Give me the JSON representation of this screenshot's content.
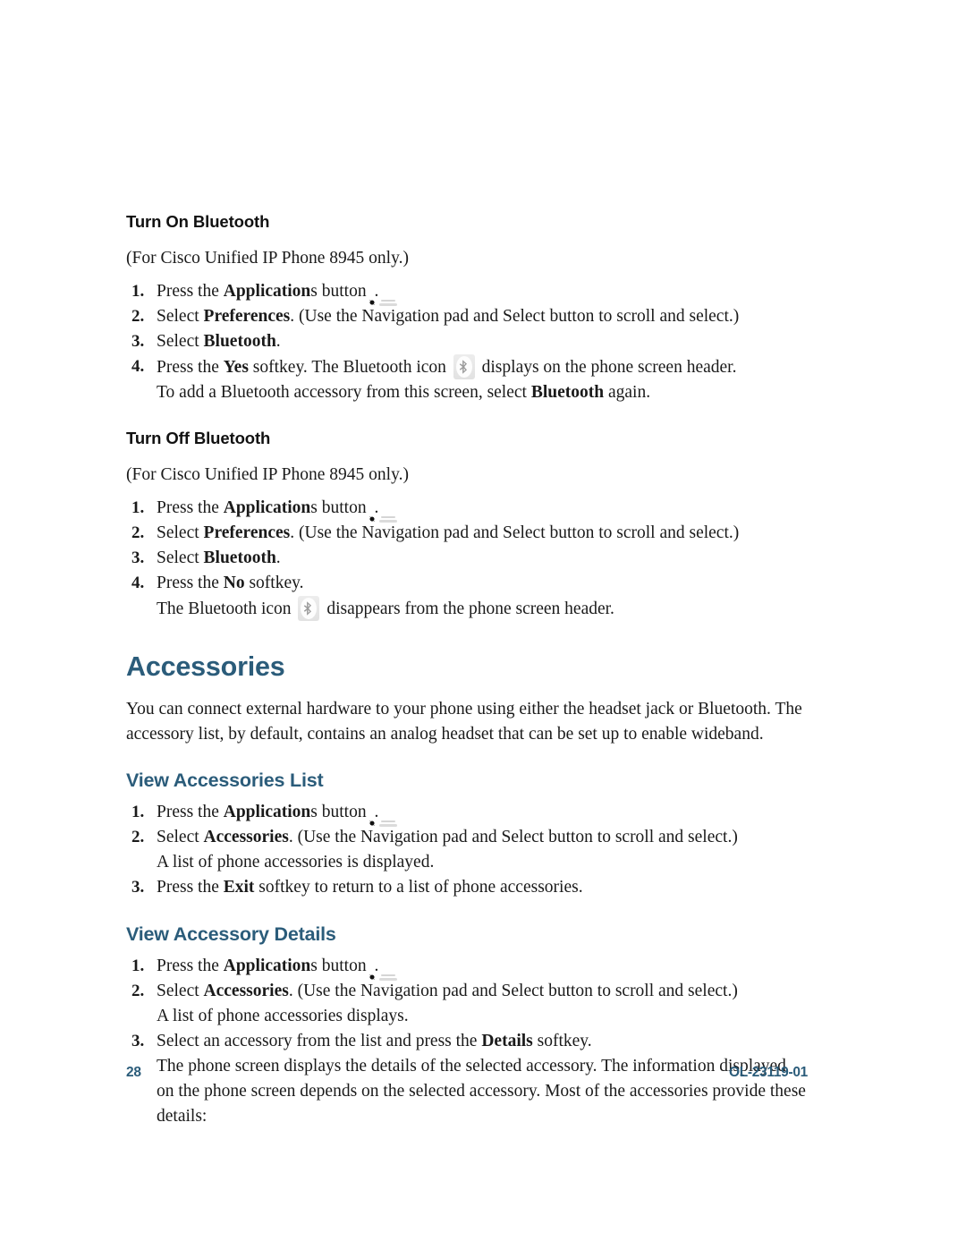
{
  "document": {
    "page_number": "28",
    "doc_id": "OL-23119-01",
    "accent_color": "#2b5c7a",
    "text_color": "#1a1a1a"
  },
  "icons": {
    "applications_button": "applications-gear-button-icon",
    "bluetooth_badge": "bluetooth-status-icon"
  },
  "sections": [
    {
      "id": "turn-on-bluetooth",
      "heading": "Turn On Bluetooth",
      "heading_style": "sub-head",
      "note": "(For Cisco Unified IP Phone 8945 only.)",
      "steps": [
        {
          "num": "1.",
          "parts": [
            {
              "t": "Press the ",
              "b": false
            },
            {
              "t": "Application",
              "b": true
            },
            {
              "t": "s button ",
              "b": false
            },
            {
              "t": "",
              "icon": "apps"
            },
            {
              "t": ".",
              "b": false
            }
          ]
        },
        {
          "num": "2.",
          "parts": [
            {
              "t": "Select ",
              "b": false
            },
            {
              "t": "Preferences",
              "b": true
            },
            {
              "t": ". (Use the Navigation pad and Select button to scroll and select.)",
              "b": false
            }
          ]
        },
        {
          "num": "3.",
          "parts": [
            {
              "t": "Select ",
              "b": false
            },
            {
              "t": "Bluetooth",
              "b": true
            },
            {
              "t": ".",
              "b": false
            }
          ]
        },
        {
          "num": "4.",
          "parts": [
            {
              "t": "Press the ",
              "b": false
            },
            {
              "t": "Yes",
              "b": true
            },
            {
              "t": " softkey. The Bluetooth icon ",
              "b": false
            },
            {
              "t": "",
              "icon": "bt"
            },
            {
              "t": " displays on the phone screen header.",
              "b": false
            }
          ],
          "continuation": [
            {
              "t": "To add a Bluetooth accessory from this screen, select ",
              "b": false
            },
            {
              "t": "Bluetooth",
              "b": true
            },
            {
              "t": " again.",
              "b": false
            }
          ]
        }
      ]
    },
    {
      "id": "turn-off-bluetooth",
      "heading": "Turn Off Bluetooth",
      "heading_style": "sub-head",
      "note": "(For Cisco Unified IP Phone 8945 only.)",
      "steps": [
        {
          "num": "1.",
          "parts": [
            {
              "t": "Press the ",
              "b": false
            },
            {
              "t": "Application",
              "b": true
            },
            {
              "t": "s button ",
              "b": false
            },
            {
              "t": "",
              "icon": "apps"
            },
            {
              "t": ".",
              "b": false
            }
          ]
        },
        {
          "num": "2.",
          "parts": [
            {
              "t": "Select ",
              "b": false
            },
            {
              "t": "Preferences",
              "b": true
            },
            {
              "t": ". (Use the Navigation pad and Select button to scroll and select.)",
              "b": false
            }
          ]
        },
        {
          "num": "3.",
          "parts": [
            {
              "t": "Select ",
              "b": false
            },
            {
              "t": "Bluetooth",
              "b": true
            },
            {
              "t": ".",
              "b": false
            }
          ]
        },
        {
          "num": "4.",
          "parts": [
            {
              "t": "Press the ",
              "b": false
            },
            {
              "t": "No",
              "b": true
            },
            {
              "t": " softkey.",
              "b": false
            }
          ],
          "continuation": [
            {
              "t": "The Bluetooth icon ",
              "b": false
            },
            {
              "t": "",
              "icon": "bt"
            },
            {
              "t": " disappears from the phone screen header.",
              "b": false
            }
          ]
        }
      ]
    },
    {
      "id": "accessories",
      "heading": "Accessories",
      "heading_style": "section-title",
      "paragraph": "You can connect external hardware to your phone using either the headset jack or Bluetooth. The accessory list, by default, contains an analog headset that can be set up to enable wideband."
    },
    {
      "id": "view-accessories-list",
      "heading": "View Accessories List",
      "heading_style": "blue-head",
      "steps": [
        {
          "num": "1.",
          "parts": [
            {
              "t": "Press the ",
              "b": false
            },
            {
              "t": "Application",
              "b": true
            },
            {
              "t": "s button ",
              "b": false
            },
            {
              "t": "",
              "icon": "apps"
            },
            {
              "t": ".",
              "b": false
            }
          ]
        },
        {
          "num": "2.",
          "parts": [
            {
              "t": "Select ",
              "b": false
            },
            {
              "t": "Accessories",
              "b": true
            },
            {
              "t": ". (Use the Navigation pad and Select button to scroll and select.)",
              "b": false
            }
          ],
          "continuation": [
            {
              "t": "A list of phone accessories is displayed.",
              "b": false
            }
          ]
        },
        {
          "num": "3.",
          "parts": [
            {
              "t": "Press the ",
              "b": false
            },
            {
              "t": "Exit",
              "b": true
            },
            {
              "t": " softkey to return to a list of phone accessories.",
              "b": false
            }
          ]
        }
      ]
    },
    {
      "id": "view-accessory-details",
      "heading": "View Accessory Details",
      "heading_style": "blue-head",
      "steps": [
        {
          "num": "1.",
          "parts": [
            {
              "t": "Press the ",
              "b": false
            },
            {
              "t": "Application",
              "b": true
            },
            {
              "t": "s button ",
              "b": false
            },
            {
              "t": "",
              "icon": "apps"
            },
            {
              "t": ".",
              "b": false
            }
          ]
        },
        {
          "num": "2.",
          "parts": [
            {
              "t": "Select ",
              "b": false
            },
            {
              "t": "Accessories",
              "b": true
            },
            {
              "t": ". (Use the Navigation pad and Select button to scroll and select.)",
              "b": false
            }
          ],
          "continuation": [
            {
              "t": "A list of phone accessories displays.",
              "b": false
            }
          ]
        },
        {
          "num": "3.",
          "parts": [
            {
              "t": "Select an accessory from the list and press the ",
              "b": false
            },
            {
              "t": "Details",
              "b": true
            },
            {
              "t": " softkey.",
              "b": false
            }
          ],
          "continuation": [
            {
              "t": "The phone screen displays the details of the selected accessory. The information displayed on the phone screen depends on the selected accessory. Most of the accessories provide these details:",
              "b": false
            }
          ]
        }
      ]
    }
  ]
}
